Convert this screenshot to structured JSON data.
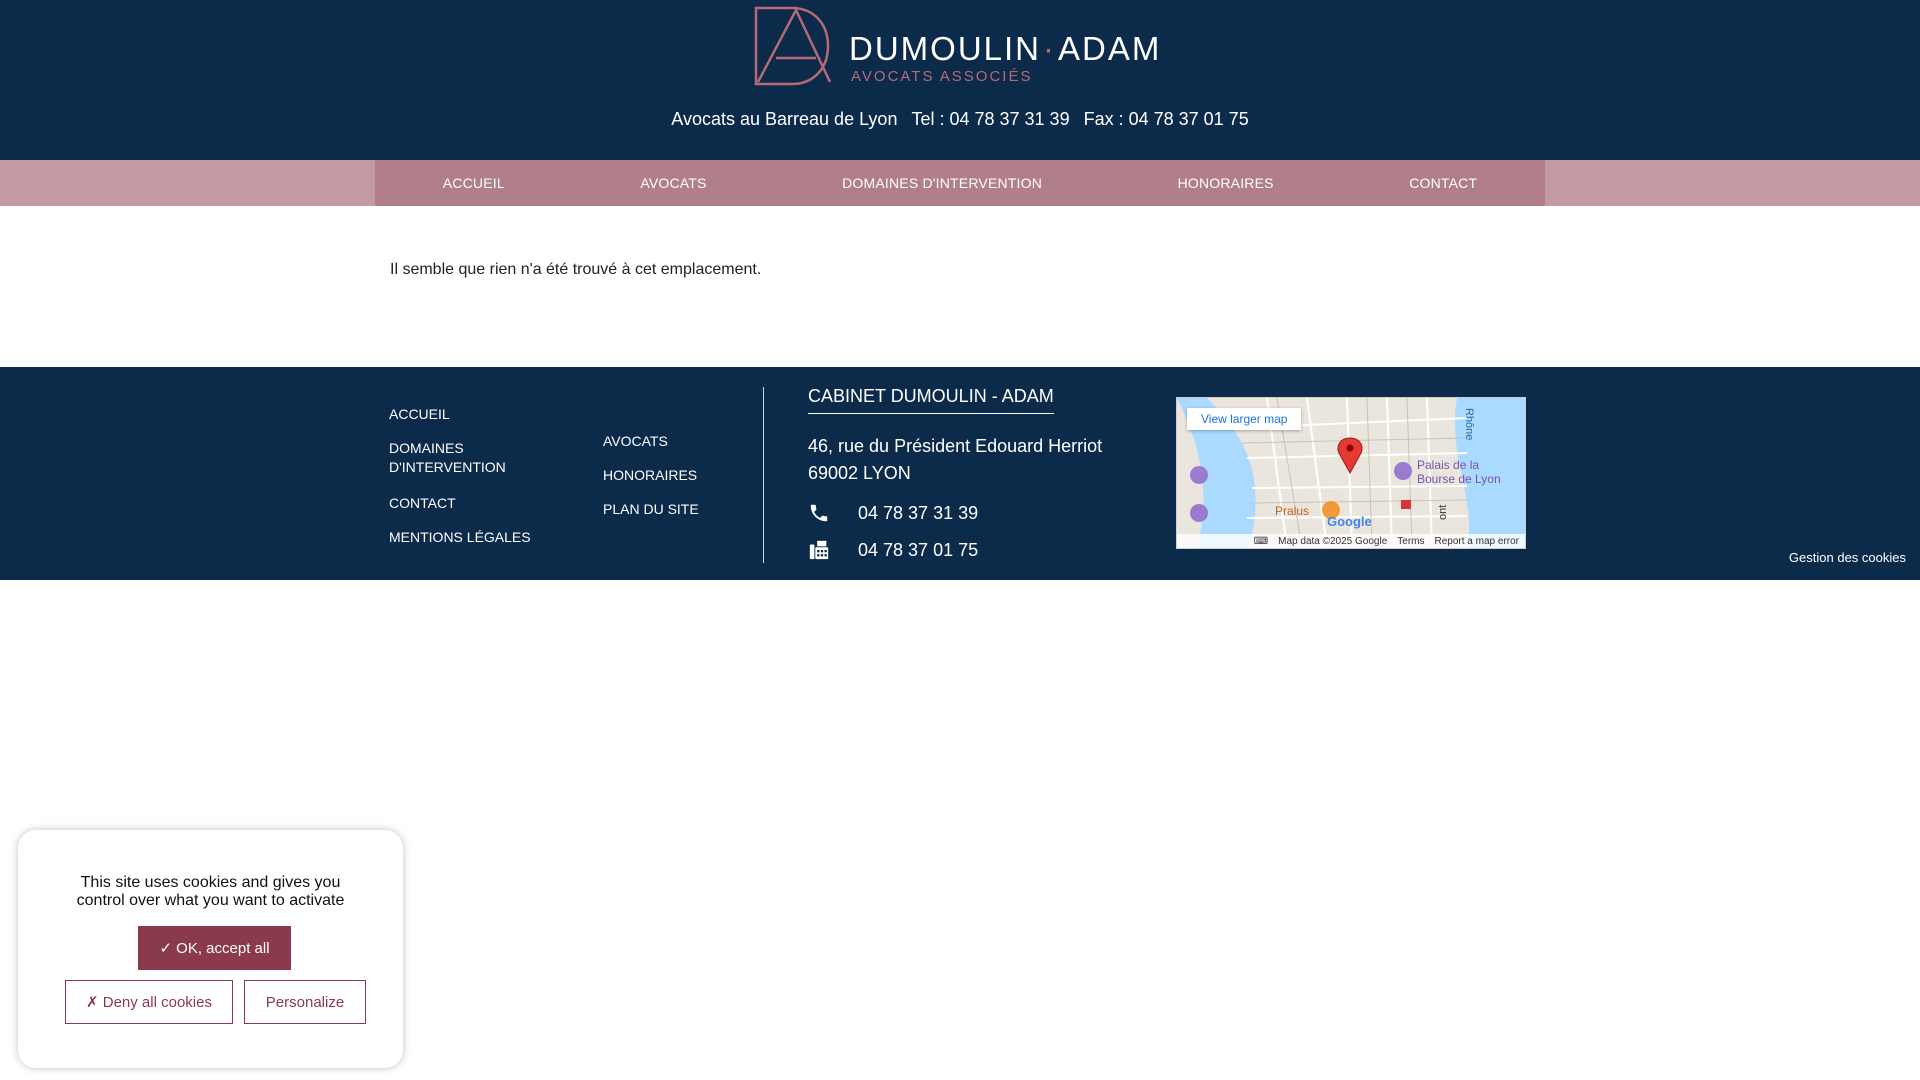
{
  "header": {
    "logo_name_1": "DUMOULIN",
    "logo_name_2": "ADAM",
    "logo_subtitle": "AVOCATS ASSOCIÉS",
    "tagline": "Avocats au Barreau de Lyon",
    "tel": "Tel : 04 78 37 31 39",
    "fax": "Fax : 04 78 37 01 75"
  },
  "nav": {
    "items": [
      {
        "label": "ACCUEIL"
      },
      {
        "label": "AVOCATS"
      },
      {
        "label": "DOMAINES D'INTERVENTION"
      },
      {
        "label": "HONORAIRES"
      },
      {
        "label": "CONTACT"
      }
    ]
  },
  "main": {
    "message": "Il semble que rien n'a été trouvé à cet emplacement."
  },
  "footer": {
    "col1": [
      {
        "label": "ACCUEIL"
      },
      {
        "label_line1": "DOMAINES",
        "label_line2": "D'INTERVENTION"
      },
      {
        "label": "CONTACT"
      },
      {
        "label": "MENTIONS LÉGALES"
      }
    ],
    "col2": [
      {
        "label": "AVOCATS"
      },
      {
        "label": "HONORAIRES"
      },
      {
        "label": "PLAN DU SITE"
      }
    ],
    "cabinet_title": "CABINET DUMOULIN - ADAM",
    "address_line1": "46, rue du Président Edouard Herriot",
    "address_line2": "69002 LYON",
    "phone": "04 78 37 31 39",
    "fax": "04 78 37 01 75",
    "cookie_management": "Gestion des cookies"
  },
  "map": {
    "larger_map": "View larger map",
    "label_rhone": "Rhône",
    "label_palais_1": "Palais de la",
    "label_palais_2": "Bourse de Lyon",
    "label_pralus": "Pralus",
    "label_google": "Google",
    "label_ont": "ont",
    "map_data": "Map data ©2025 Google",
    "terms": "Terms",
    "report": "Report a map error"
  },
  "cookie_banner": {
    "text_line1": "This site uses cookies and gives you",
    "text_line2": "control over what you want to activate",
    "accept": "✓ OK, accept all",
    "deny": "✗ Deny all cookies",
    "personalize": "Personalize"
  },
  "colors": {
    "navy": "#0c2a4a",
    "rose": "#b07f8b",
    "rose_light": "#c49ba5",
    "burgundy": "#8a3a4a"
  }
}
